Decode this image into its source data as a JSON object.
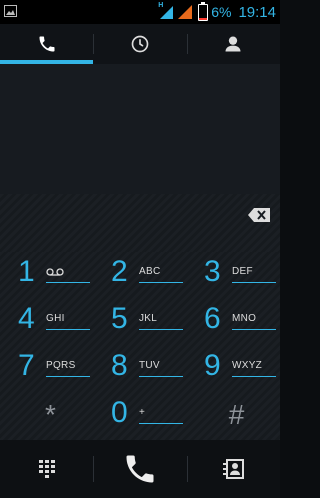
{
  "status_bar": {
    "network_type": "H",
    "battery_percent": "6%",
    "time": "19:14"
  },
  "tabs": [
    {
      "name": "phone",
      "icon": "phone-icon",
      "active": true
    },
    {
      "name": "call-log",
      "icon": "clock-icon",
      "active": false
    },
    {
      "name": "contacts",
      "icon": "contact-icon",
      "active": false
    }
  ],
  "keypad": {
    "keys": [
      {
        "digit": "1",
        "letters": ""
      },
      {
        "digit": "2",
        "letters": "ABC"
      },
      {
        "digit": "3",
        "letters": "DEF"
      },
      {
        "digit": "4",
        "letters": "GHI"
      },
      {
        "digit": "5",
        "letters": "JKL"
      },
      {
        "digit": "6",
        "letters": "MNO"
      },
      {
        "digit": "7",
        "letters": "PQRS"
      },
      {
        "digit": "8",
        "letters": "TUV"
      },
      {
        "digit": "9",
        "letters": "WXYZ"
      },
      {
        "symbol": "*"
      },
      {
        "digit": "0",
        "letters": "+"
      },
      {
        "symbol": "#"
      }
    ]
  },
  "bottom_bar": [
    {
      "icon": "dialpad-icon"
    },
    {
      "icon": "call-icon"
    },
    {
      "icon": "add-contact-icon"
    }
  ],
  "colors": {
    "accent": "#33b5e5",
    "background": "#0b0d10",
    "battery_low": "#ff3b30"
  }
}
